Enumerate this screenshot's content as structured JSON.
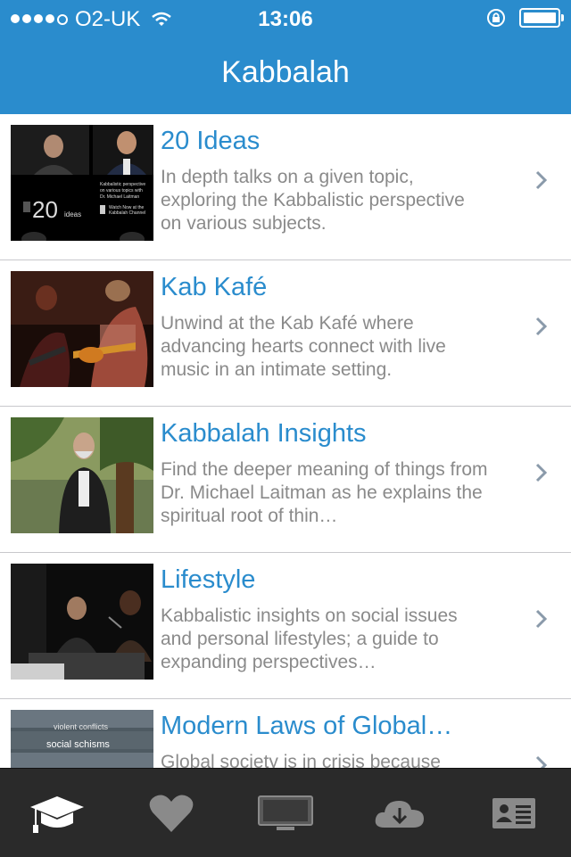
{
  "status_bar": {
    "carrier": "O2-UK",
    "time": "13:06"
  },
  "header": {
    "title": "Kabbalah"
  },
  "items": [
    {
      "title": "20 Ideas",
      "description": "In depth talks on a given topic, exploring the Kabbalistic perspective on various subjects.",
      "thumb_text": {
        "line1": "Kabbalistic perspective",
        "line2": "on various topics with",
        "line3": "Dr. Michael Laitman",
        "big": "20",
        "small": "ideas",
        "watch1": "Watch Now at the",
        "watch2": "Kabbalah Channel"
      }
    },
    {
      "title": "Kab Kafé",
      "description": "Unwind at the Kab Kafé where advancing hearts connect with live music in an intimate setting."
    },
    {
      "title": "Kabbalah Insights",
      "description": "Find the deeper meaning of things from Dr. Michael Laitman as he explains the spiritual root of thin…"
    },
    {
      "title": "Lifestyle",
      "description": "Kabbalistic insights on social issues and personal lifestyles; a guide to expanding perspectives…"
    },
    {
      "title": "Modern Laws of Global…",
      "description": "Global society is in crisis because",
      "thumb_text": {
        "line1": "violent conflicts",
        "line2": "social schisms"
      }
    }
  ],
  "tabbar": {
    "tabs": [
      {
        "icon": "graduation-cap-icon",
        "active": true
      },
      {
        "icon": "heart-icon",
        "active": false
      },
      {
        "icon": "tv-icon",
        "active": false
      },
      {
        "icon": "cloud-download-icon",
        "active": false
      },
      {
        "icon": "contact-card-icon",
        "active": false
      }
    ]
  },
  "colors": {
    "header": "#2a8ccd",
    "title_text": "#2a8ccd",
    "desc_text": "#8a8a8a",
    "tabbar": "#2a2a2a"
  }
}
